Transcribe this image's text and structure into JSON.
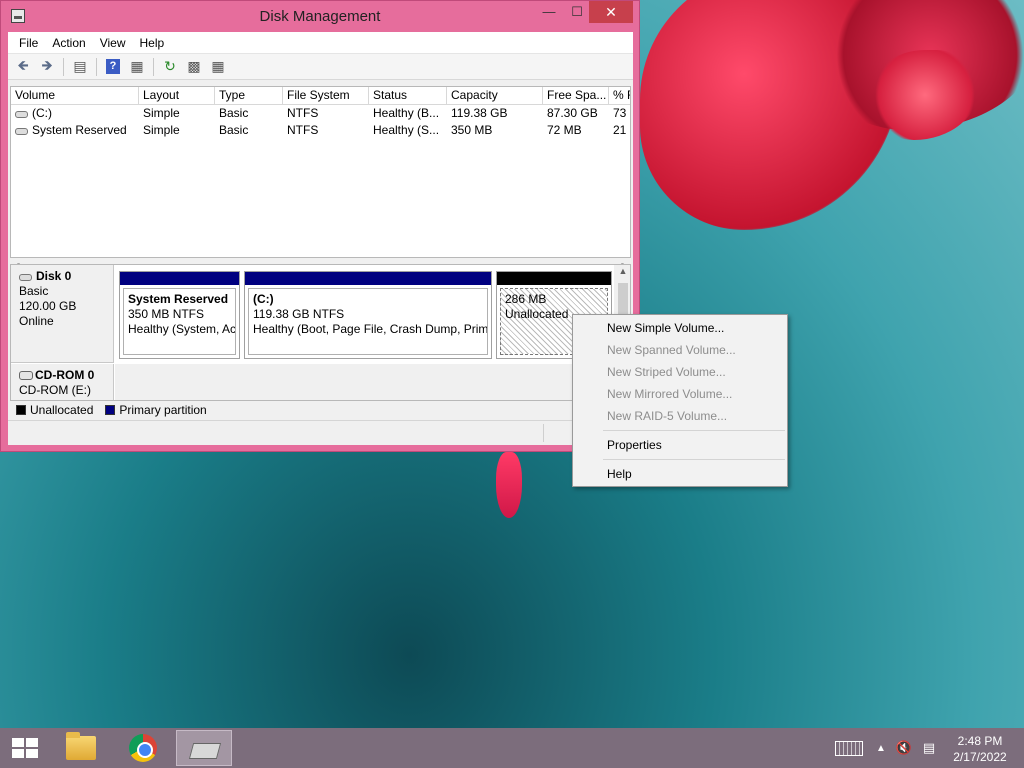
{
  "window": {
    "title": "Disk Management"
  },
  "menubar": [
    "File",
    "Action",
    "View",
    "Help"
  ],
  "volume_list": {
    "columns": [
      "Volume",
      "Layout",
      "Type",
      "File System",
      "Status",
      "Capacity",
      "Free Spa...",
      "% F"
    ],
    "rows": [
      [
        "(C:)",
        "Simple",
        "Basic",
        "NTFS",
        "Healthy (B...",
        "119.38 GB",
        "87.30 GB",
        "73"
      ],
      [
        "System Reserved",
        "Simple",
        "Basic",
        "NTFS",
        "Healthy (S...",
        "350 MB",
        "72 MB",
        "21"
      ]
    ]
  },
  "disks": {
    "disk0": {
      "name": "Disk 0",
      "type": "Basic",
      "size": "120.00 GB",
      "state": "Online",
      "partitions": [
        {
          "title": "System Reserved",
          "size": "350 MB NTFS",
          "status": "Healthy (System, Act",
          "bar_color": "#000080"
        },
        {
          "title": "(C:)",
          "size": "119.38 GB NTFS",
          "status": "Healthy (Boot, Page File, Crash Dump, Prima",
          "bar_color": "#000080"
        },
        {
          "title": "",
          "size": "286 MB",
          "status": "Unallocated",
          "bar_color": "#000000"
        }
      ]
    },
    "cdrom0": {
      "name": "CD-ROM 0",
      "drive": "CD-ROM (E:)"
    }
  },
  "legend": {
    "unallocated": {
      "label": "Unallocated",
      "color": "#000000"
    },
    "primary": {
      "label": "Primary partition",
      "color": "#000080"
    }
  },
  "context_menu": {
    "new_simple": "New Simple Volume...",
    "new_spanned": "New Spanned Volume...",
    "new_striped": "New Striped Volume...",
    "new_mirrored": "New Mirrored Volume...",
    "new_raid5": "New RAID-5 Volume...",
    "properties": "Properties",
    "help": "Help"
  },
  "taskbar": {
    "apps": [
      "file-explorer-icon",
      "chrome-icon",
      "disk-management-icon"
    ],
    "clock_time": "2:48 PM",
    "clock_date": "2/17/2022"
  },
  "colors": {
    "window_frame": "#e66d9c",
    "close_button": "#c7404c",
    "taskbar": "#7c6d7c"
  }
}
